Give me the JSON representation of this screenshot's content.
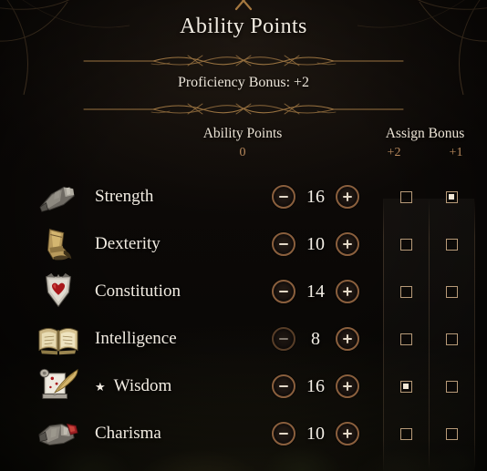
{
  "panel": {
    "title": "Ability Points",
    "proficiency_bonus_label": "Proficiency Bonus: +2"
  },
  "headers": {
    "ability_points_label": "Ability Points",
    "ability_points_remaining": "0",
    "assign_bonus_label": "Assign Bonus",
    "bonus_col_2": "+2",
    "bonus_col_1": "+1"
  },
  "icons": {
    "top_ornament": "x-ornament-icon",
    "divider": "vine-filigree-divider-icon",
    "corner": "corner-filigree-icon",
    "star": "★"
  },
  "abilities": [
    {
      "name": "Strength",
      "icon": "gauntlet-icon",
      "value": "16",
      "starred": false,
      "decrement_enabled": true,
      "increment_enabled": true,
      "bonus_2_checked": false,
      "bonus_1_checked": true
    },
    {
      "name": "Dexterity",
      "icon": "boot-icon",
      "value": "10",
      "starred": false,
      "decrement_enabled": true,
      "increment_enabled": true,
      "bonus_2_checked": false,
      "bonus_1_checked": false
    },
    {
      "name": "Constitution",
      "icon": "heart-shield-icon",
      "value": "14",
      "starred": false,
      "decrement_enabled": true,
      "increment_enabled": true,
      "bonus_2_checked": false,
      "bonus_1_checked": false
    },
    {
      "name": "Intelligence",
      "icon": "open-book-icon",
      "value": "8",
      "starred": false,
      "decrement_enabled": false,
      "increment_enabled": true,
      "bonus_2_checked": false,
      "bonus_1_checked": false
    },
    {
      "name": "Wisdom",
      "icon": "scroll-quill-icon",
      "value": "16",
      "starred": true,
      "decrement_enabled": true,
      "increment_enabled": true,
      "bonus_2_checked": true,
      "bonus_1_checked": false
    },
    {
      "name": "Charisma",
      "icon": "gauntlet-hand-icon",
      "value": "10",
      "starred": false,
      "decrement_enabled": true,
      "increment_enabled": true,
      "bonus_2_checked": false,
      "bonus_1_checked": false
    }
  ],
  "colors": {
    "accent_bronze": "#b8895c",
    "ring_bronze": "#8a5f3d",
    "text_cream": "#f2ece2",
    "checkbox_border": "#b79a78",
    "background_dark": "#0a0806"
  }
}
